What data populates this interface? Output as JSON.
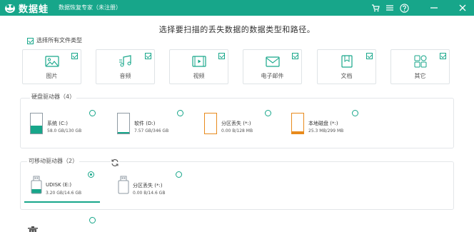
{
  "app": {
    "name": "数据蛙",
    "subtitle": "数据恢复专家（未注册）"
  },
  "colors": {
    "accent": "#17a68a",
    "warning": "#e88a1c"
  },
  "toolbar_icons": [
    "cart-icon",
    "menu-icon",
    "help-icon",
    "minimize-icon",
    "close-icon"
  ],
  "prompt": "选择要扫描的丢失数据的数据类型和路径。",
  "select_all": {
    "label": "选择所有文件类型",
    "checked": true
  },
  "file_types": [
    {
      "label": "图片",
      "icon": "image-icon",
      "checked": true
    },
    {
      "label": "音频",
      "icon": "audio-icon",
      "checked": true
    },
    {
      "label": "视频",
      "icon": "video-icon",
      "checked": true
    },
    {
      "label": "电子邮件",
      "icon": "email-icon",
      "checked": true
    },
    {
      "label": "文档",
      "icon": "document-icon",
      "checked": true
    },
    {
      "label": "其它",
      "icon": "other-icon",
      "checked": true
    }
  ],
  "hard_drives": {
    "title": "硬盘驱动器（4）",
    "items": [
      {
        "name": "系统 (C:)",
        "size": "58.0 GB/130 GB",
        "fill": 0.45,
        "selected": false
      },
      {
        "name": "软件 (D:)",
        "size": "7.57 GB/346 GB",
        "fill": 0.02,
        "selected": false
      },
      {
        "name": "分区丢失 (*:)",
        "size": "0.00  B/128 MB",
        "fill": 0.0,
        "selected": false
      },
      {
        "name": "本地磁盘 (*:)",
        "size": "25.3 MB/299 MB",
        "fill": 0.08,
        "selected": false
      }
    ]
  },
  "removable_drives": {
    "title": "可移动驱动器（2）",
    "refresh_icon": "refresh-icon",
    "items": [
      {
        "name": "UDISK (E:)",
        "size": "3.20 GB/14.6 GB",
        "fill": 0.22,
        "selected": true
      },
      {
        "name": "分区丢失 (*:)",
        "size": "0.00  B/14.6 GB",
        "fill": 0.0,
        "selected": false
      }
    ]
  },
  "recycle": {
    "icon": "trash-icon",
    "selected": false
  }
}
